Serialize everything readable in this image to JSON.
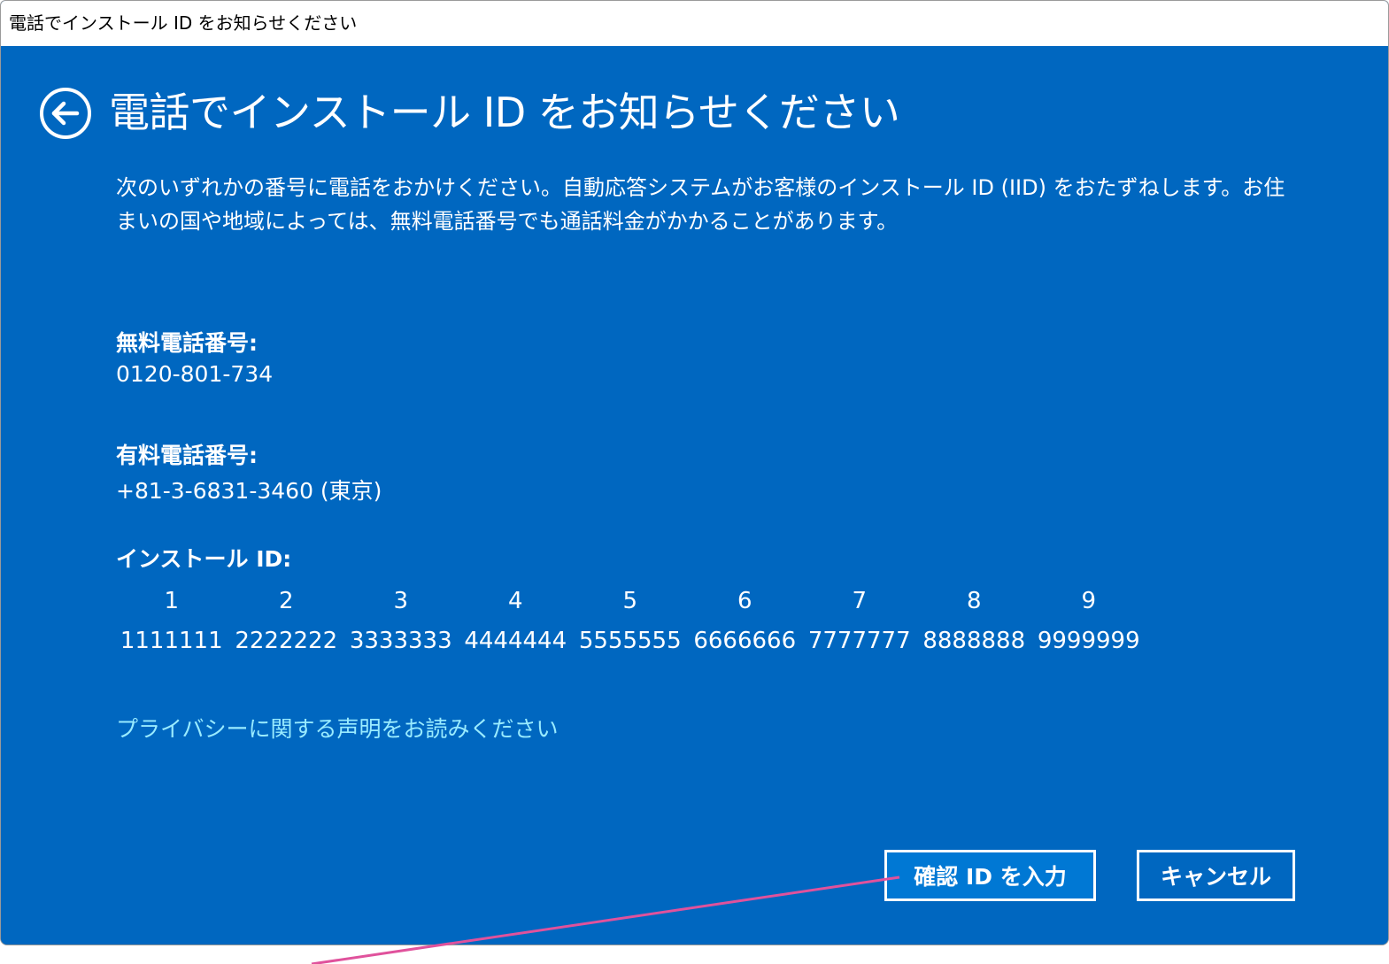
{
  "window": {
    "title": "電話でインストール ID をお知らせください"
  },
  "page": {
    "title": "電話でインストール ID をお知らせください",
    "description": "次のいずれかの番号に電話をおかけください。自動応答システムがお客様のインストール ID (IID) をおたずねします。お住まいの国や地域によっては、無料電話番号でも通話料金がかかることがあります。"
  },
  "toll_free": {
    "label": "無料電話番号:",
    "number": "0120-801-734"
  },
  "toll": {
    "label": "有料電話番号:",
    "number": "+81-3-6831-3460 (東京)"
  },
  "install_id": {
    "label": "インストール ID:",
    "groups": [
      {
        "index": "1",
        "value": "1111111"
      },
      {
        "index": "2",
        "value": "2222222"
      },
      {
        "index": "3",
        "value": "3333333"
      },
      {
        "index": "4",
        "value": "4444444"
      },
      {
        "index": "5",
        "value": "5555555"
      },
      {
        "index": "6",
        "value": "6666666"
      },
      {
        "index": "7",
        "value": "7777777"
      },
      {
        "index": "8",
        "value": "8888888"
      },
      {
        "index": "9",
        "value": "9999999"
      }
    ]
  },
  "privacy_link": "プライバシーに関する声明をお読みください",
  "buttons": {
    "enter_confirmation_id": "確認 ID を入力",
    "cancel": "キャンセル"
  },
  "icons": {
    "back": "back-arrow-icon"
  },
  "colors": {
    "background": "#0067c0",
    "primary_button": "#0078d4",
    "link": "#99ebff",
    "annotation": "#e0529c"
  }
}
